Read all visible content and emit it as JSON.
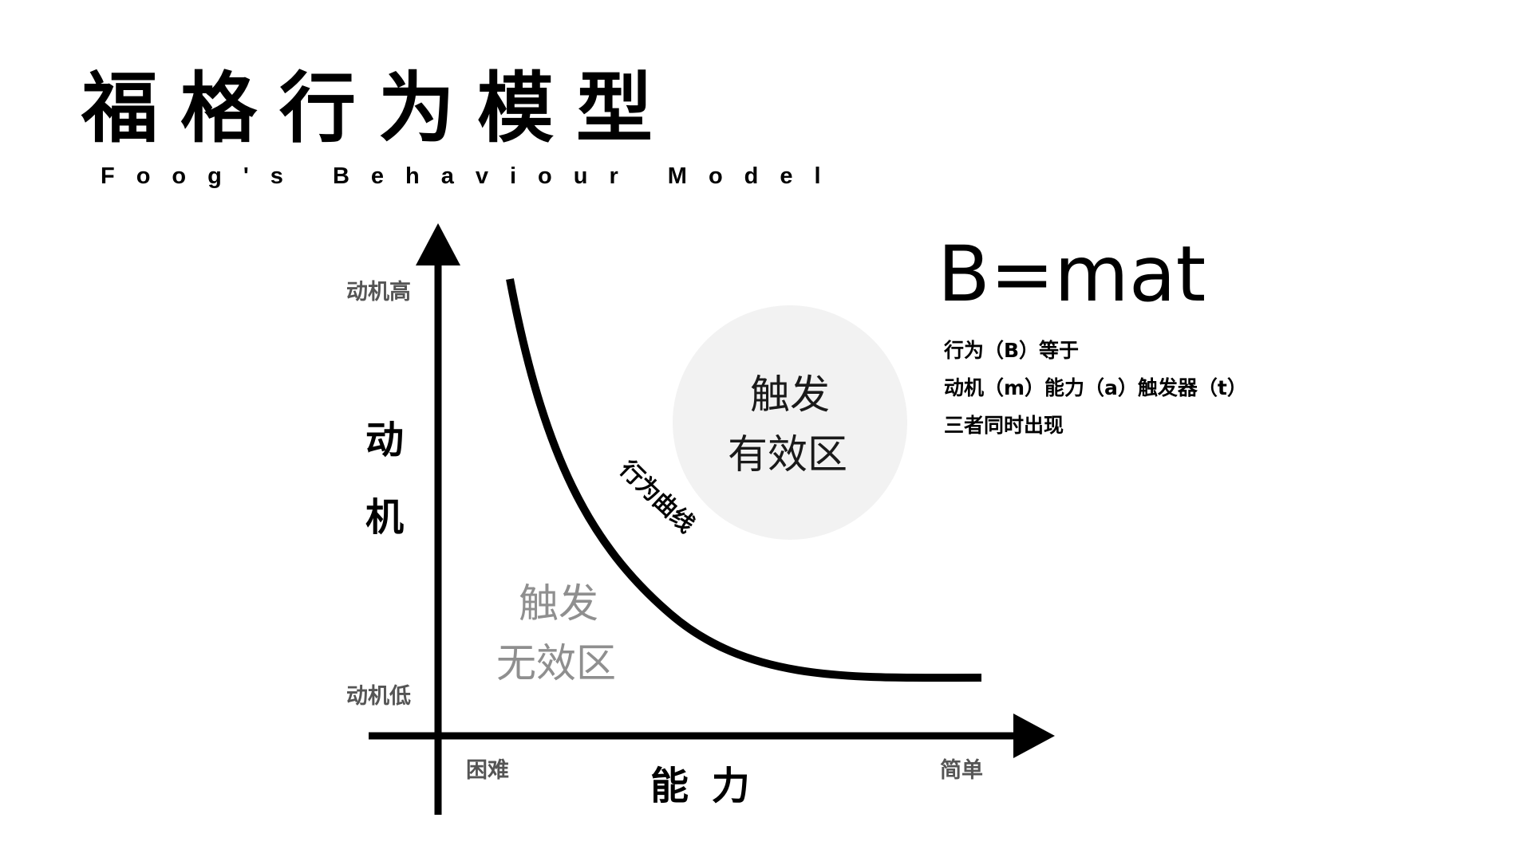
{
  "title": "福格行为模型",
  "subtitle": "Foog's Behaviour Model",
  "formula": {
    "expression": "B=mat",
    "lines": [
      "行为（B）等于",
      "动机（m）能力（a）触发器（t）",
      "三者同时出现"
    ]
  },
  "axes": {
    "y_label": [
      "动",
      "机"
    ],
    "y_high": "动机高",
    "y_low": "动机低",
    "x_label": "能 力",
    "x_low": "困难",
    "x_high": "简单"
  },
  "curve_label": "行为曲线",
  "zones": {
    "effective": [
      "触发",
      "有效区"
    ],
    "ineffective": [
      "触发",
      "无效区"
    ]
  },
  "colors": {
    "ink": "#000000",
    "muted_label": "#555555",
    "ineffective_text": "#8f8f8f",
    "effective_circle": "#f2f2f2",
    "effective_text": "#1a1a1a"
  }
}
